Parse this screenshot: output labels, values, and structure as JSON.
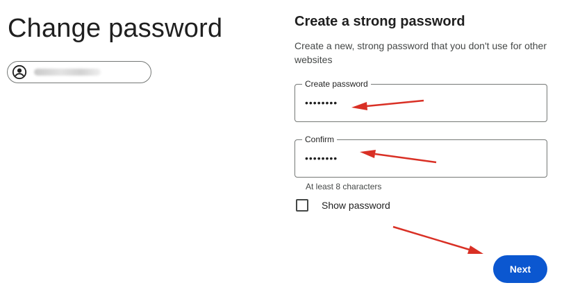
{
  "page": {
    "title": "Change password"
  },
  "account": {
    "avatar_icon": "account-circle-icon"
  },
  "form": {
    "heading": "Create a strong password",
    "description": "Create a new, strong password that you don't use for other websites",
    "create_password": {
      "label": "Create password",
      "value": "••••••••"
    },
    "confirm_password": {
      "label": "Confirm",
      "value": "••••••••"
    },
    "helper": "At least 8 characters",
    "show_password_label": "Show password",
    "show_password_checked": false,
    "next_label": "Next"
  },
  "colors": {
    "primary": "#0b57d0",
    "annotation_arrow": "#d93025",
    "text": "#1f1f1f",
    "muted": "#444746",
    "border": "#747775"
  }
}
